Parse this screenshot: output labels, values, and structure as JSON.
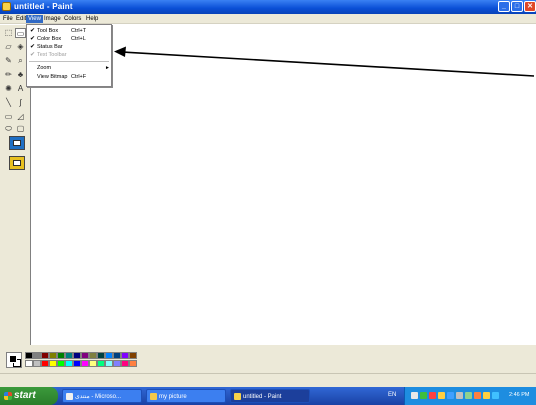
{
  "window": {
    "title": "untitled - Paint",
    "minimize": "_",
    "maximize": "□",
    "close": "✕"
  },
  "menubar": {
    "items": [
      "File",
      "Edit",
      "View",
      "Image",
      "Colors",
      "Help"
    ],
    "active_index": 2
  },
  "view_menu": {
    "items": [
      {
        "label": "Tool Box",
        "shortcut": "Ctrl+T",
        "checked": true,
        "disabled": false
      },
      {
        "label": "Color Box",
        "shortcut": "Ctrl+L",
        "checked": true,
        "disabled": false
      },
      {
        "label": "Status Bar",
        "shortcut": "",
        "checked": true,
        "disabled": false
      },
      {
        "label": "Text Toolbar",
        "shortcut": "",
        "checked": true,
        "disabled": true
      },
      {
        "label": "Zoom",
        "shortcut": "",
        "checked": false,
        "disabled": false,
        "submenu": true
      },
      {
        "label": "View Bitmap",
        "shortcut": "Ctrl+F",
        "checked": false,
        "disabled": false
      }
    ],
    "check_glyph": "✔",
    "submenu_glyph": "►"
  },
  "toolbox": {
    "tools": [
      {
        "icon": "free-form-select-icon",
        "glyph": "⬚"
      },
      {
        "icon": "select-icon",
        "glyph": "▭"
      },
      {
        "icon": "eraser-icon",
        "glyph": "▱"
      },
      {
        "icon": "fill-icon",
        "glyph": "◈"
      },
      {
        "icon": "pick-color-icon",
        "glyph": "✎"
      },
      {
        "icon": "magnifier-icon",
        "glyph": "⌕"
      },
      {
        "icon": "pencil-icon",
        "glyph": "✏"
      },
      {
        "icon": "brush-icon",
        "glyph": "♣"
      },
      {
        "icon": "airbrush-icon",
        "glyph": "✺"
      },
      {
        "icon": "text-icon",
        "glyph": "A"
      },
      {
        "icon": "line-icon",
        "glyph": "╲"
      },
      {
        "icon": "curve-icon",
        "glyph": "∫"
      },
      {
        "icon": "rectangle-icon",
        "glyph": "▭"
      },
      {
        "icon": "polygon-icon",
        "glyph": "◿"
      },
      {
        "icon": "ellipse-icon",
        "glyph": "⬭"
      },
      {
        "icon": "rounded-rectangle-icon",
        "glyph": "▢"
      }
    ],
    "selected_index": 1
  },
  "palette": {
    "foreground": "#000000",
    "background": "#ffffff",
    "row1": [
      "#000000",
      "#808080",
      "#800000",
      "#808000",
      "#008000",
      "#008080",
      "#000080",
      "#800080",
      "#808040",
      "#004040",
      "#0080ff",
      "#004080",
      "#8000ff",
      "#804000"
    ],
    "row2": [
      "#ffffff",
      "#c0c0c0",
      "#ff0000",
      "#ffff00",
      "#00ff00",
      "#00ffff",
      "#0000ff",
      "#ff00ff",
      "#ffff80",
      "#00ff80",
      "#80ffff",
      "#8080ff",
      "#ff0080",
      "#ff8040"
    ]
  },
  "taskbar": {
    "start_label": "start",
    "buttons": [
      {
        "label": "منتدى - Microso...",
        "active": false,
        "icon_color": "#f0f0f0"
      },
      {
        "label": "my picture",
        "active": false,
        "icon_color": "#f2c84b"
      },
      {
        "label": "untitled - Paint",
        "active": true,
        "icon_color": "#f7d24a"
      }
    ],
    "language": "EN",
    "clock": "2:46 PM",
    "tray_colors": [
      "#e8e8e8",
      "#3fbf3f",
      "#ff4040",
      "#ffcf40",
      "#40a0ff",
      "#c0c0c0",
      "#8fd18f",
      "#ff8040",
      "#ffd040",
      "#40c0ff"
    ]
  }
}
